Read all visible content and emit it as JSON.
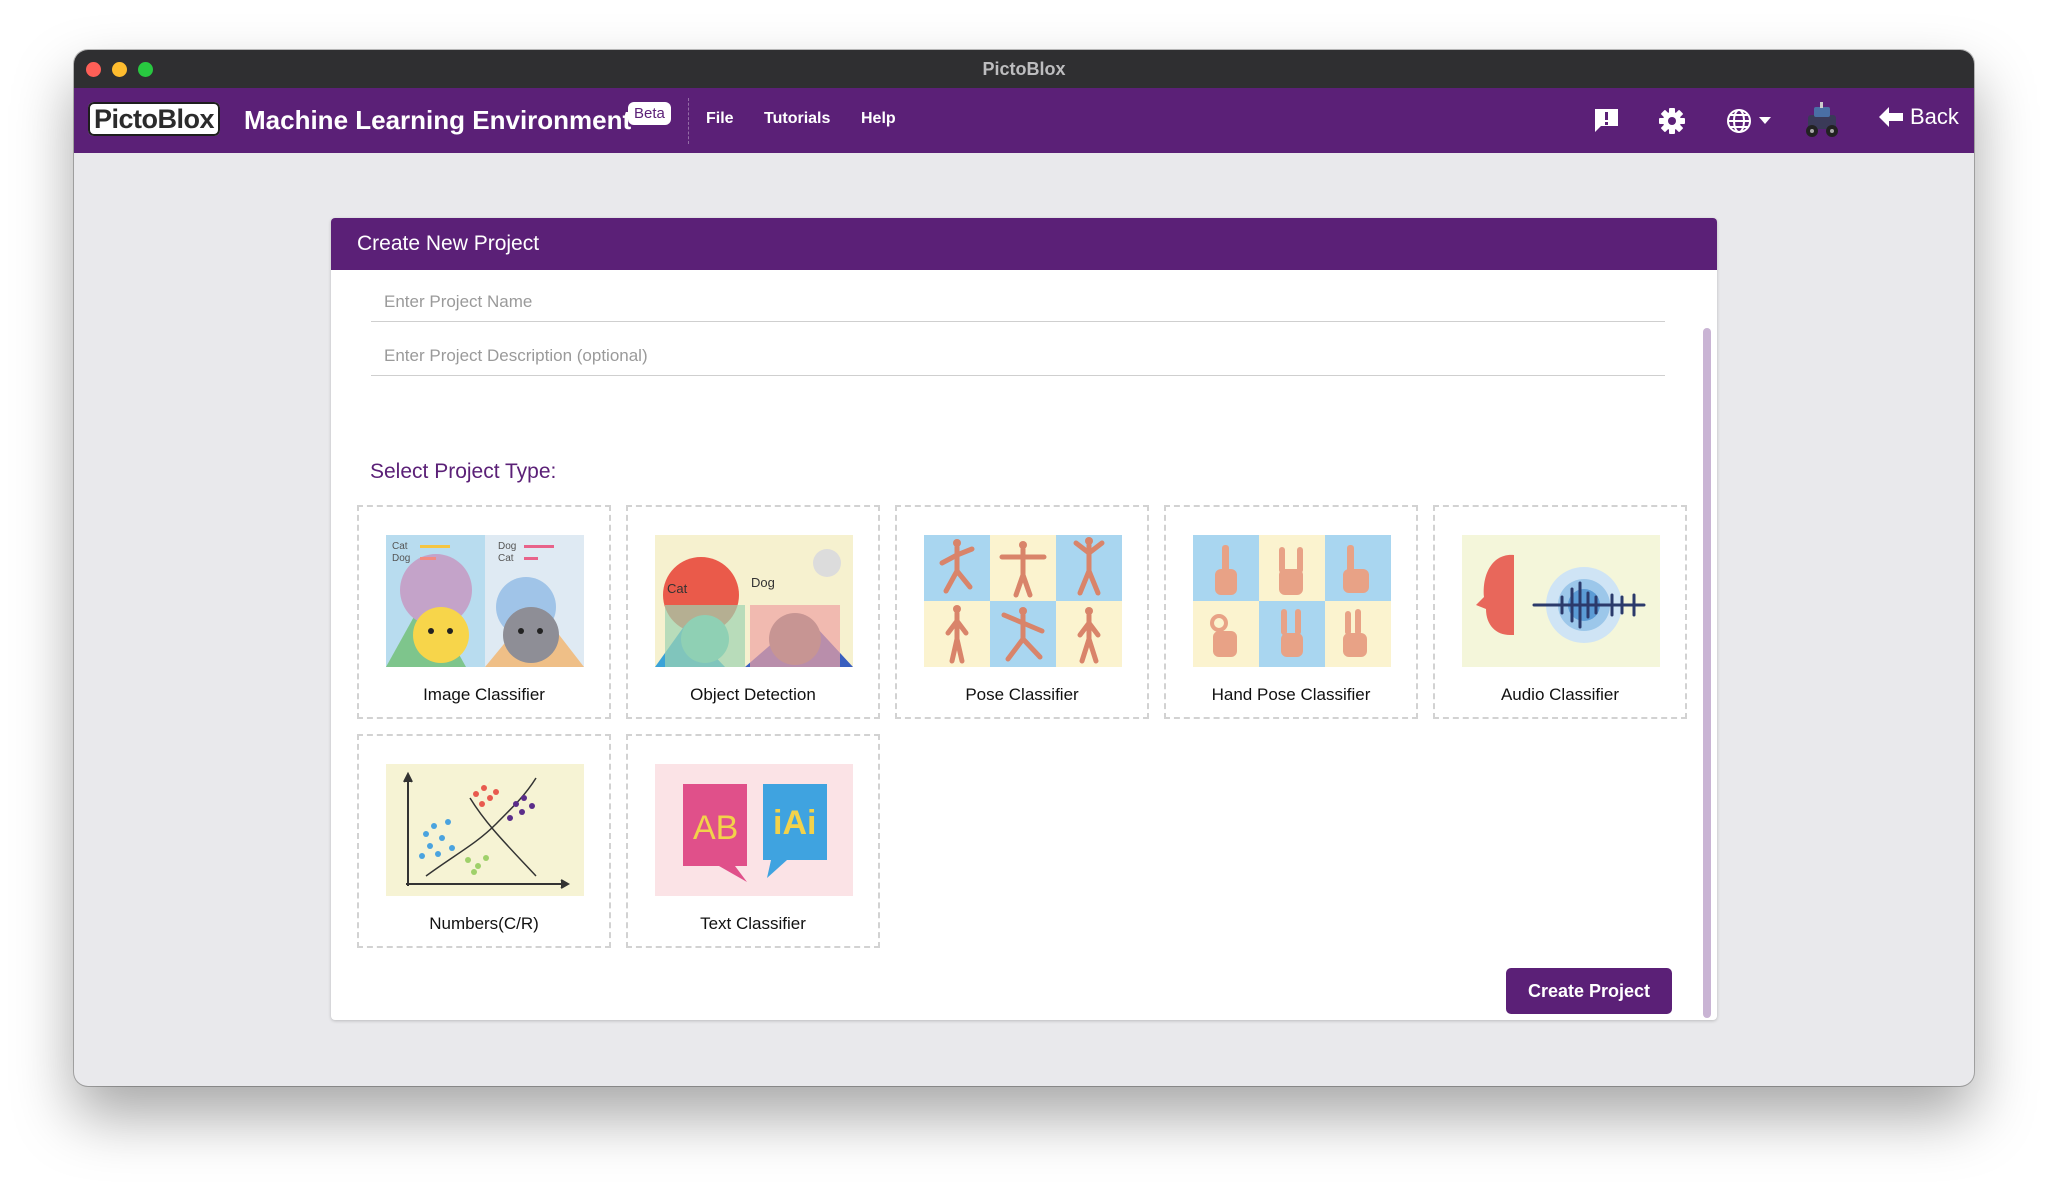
{
  "window": {
    "title": "PictoBlox"
  },
  "appbar": {
    "logo": "PictoBlox",
    "title": "Machine Learning Environment",
    "badge": "Beta",
    "menu": [
      "File",
      "Tutorials",
      "Help"
    ],
    "back_label": "Back",
    "icons": [
      "feedback-icon",
      "settings-icon",
      "globe-icon",
      "robot-icon",
      "back-arrow-icon"
    ]
  },
  "dialog": {
    "title": "Create New Project",
    "name_placeholder": "Enter Project Name",
    "description_placeholder": "Enter Project Description (optional)",
    "section_label": "Select Project Type:",
    "project_types": [
      "Image Classifier",
      "Object Detection",
      "Pose Classifier",
      "Hand Pose Classifier",
      "Audio Classifier",
      "Numbers(C/R)",
      "Text Classifier"
    ],
    "thumb_text": {
      "image_left": [
        "Cat",
        "Dog"
      ],
      "image_right": [
        "Dog",
        "Cat"
      ],
      "object": [
        "Cat",
        "Dog"
      ],
      "text": [
        "AB",
        "iAi"
      ]
    },
    "create_label": "Create Project"
  },
  "colors": {
    "brand_purple": "#5b2077",
    "page_bg": "#e9e9ec"
  }
}
